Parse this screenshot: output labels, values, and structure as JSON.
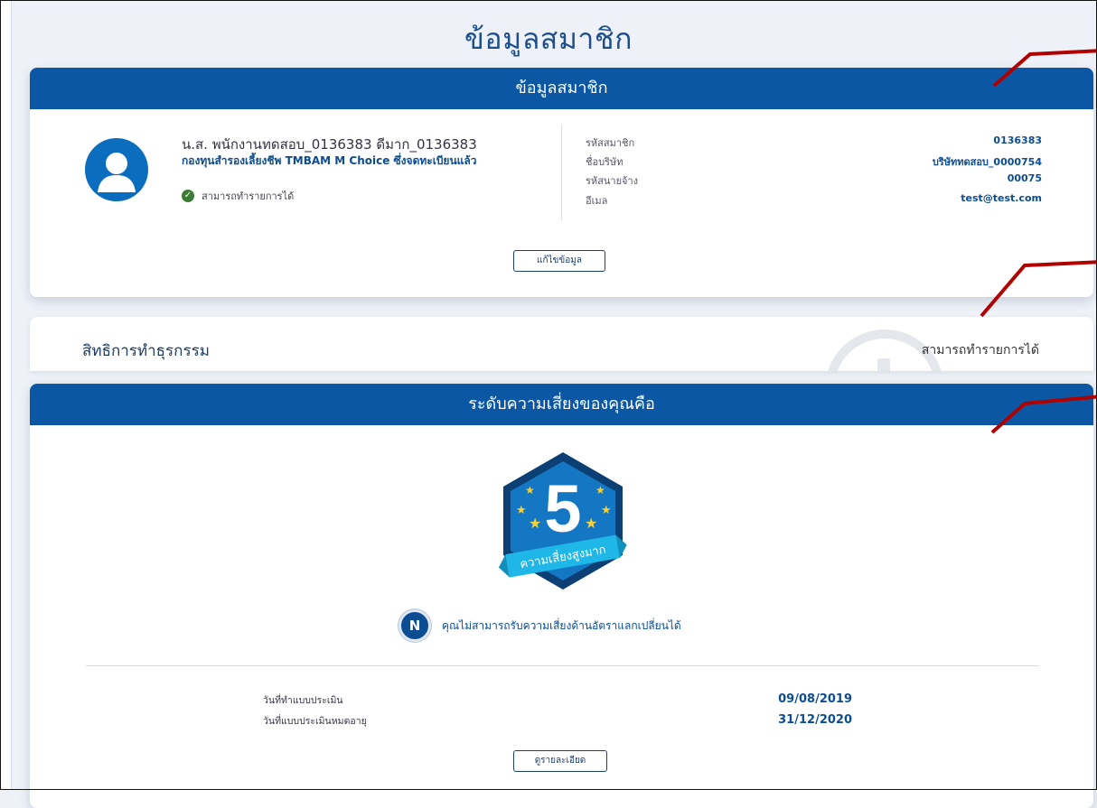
{
  "page": {
    "title": "ข้อมูลสมาชิก"
  },
  "member_card": {
    "header": "ข้อมูลสมาชิก",
    "name": "น.ส. พนักงานทดสอบ_0136383 ดีมาก_0136383",
    "plan": "กองทุนสำรองเลี้ยงชีพ TMBAM M Choice ซึ่งจดทะเบียนแล้ว",
    "status": "สามารถทำรายการได้",
    "fields": [
      {
        "label": "รหัสสมาชิก",
        "value": "0136383"
      },
      {
        "label": "ชื่อบริษัท",
        "value": "บริษัททดสอบ_0000754"
      },
      {
        "label": "รหัสนายจ้าง",
        "value": "00075"
      },
      {
        "label": "อีเมล",
        "value": "test@test.com"
      }
    ],
    "edit_button": "แก้ไขข้อมูล"
  },
  "rights": {
    "label": "สิทธิการทำธุรกรรม",
    "value": "สามารถทำรายการได้"
  },
  "risk_card": {
    "header": "ระดับความเสี่ยงของคุณคือ",
    "level": "5",
    "level_label": "ความเสี่ยงสูงมาก",
    "fx_badge": "N",
    "fx_message": "คุณไม่สามารถรับความเสี่ยงด้านอัตราแลกเปลี่ยนได้",
    "dates": [
      {
        "label": "วันที่ทำแบบประเมิน",
        "value": "09/08/2019"
      },
      {
        "label": "วันที่แบบประเมินหมดอายุ",
        "value": "31/12/2020"
      }
    ],
    "detail_button": "ดูรายละเอียด"
  },
  "colors": {
    "header_blue": "#0b57a4",
    "accent_text": "#0b4c93",
    "annotation_red": "#b00000"
  }
}
